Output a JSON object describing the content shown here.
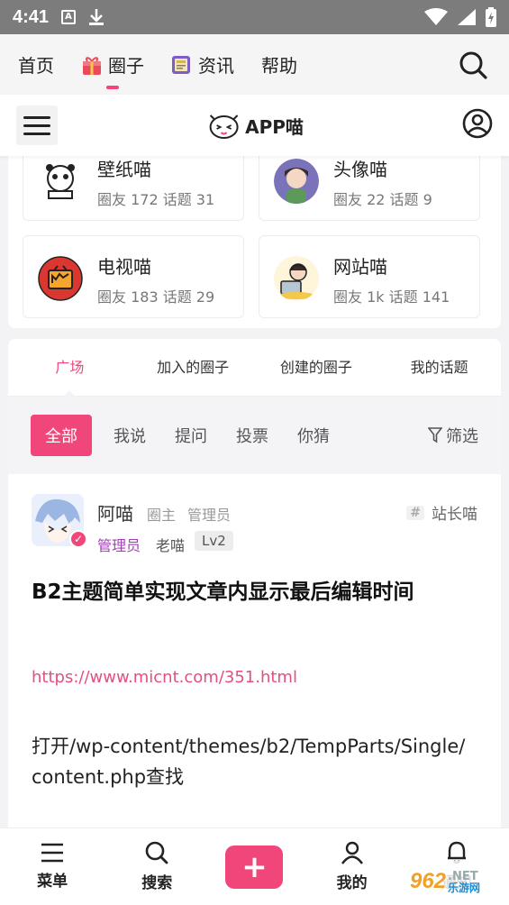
{
  "status_bar": {
    "time": "4:41"
  },
  "top_nav": {
    "items": [
      {
        "label": "首页",
        "icon": ""
      },
      {
        "label": "圈子",
        "icon": "gift-icon"
      },
      {
        "label": "资讯",
        "icon": "newspaper-icon"
      },
      {
        "label": "帮助",
        "icon": ""
      }
    ],
    "active_index": 1
  },
  "header": {
    "logo_text": "APP喵"
  },
  "circles": [
    {
      "name": "壁纸喵",
      "stats": "圈友 172 话题 31",
      "color": "#e5e5e5"
    },
    {
      "name": "头像喵",
      "stats": "圈友 22 话题 9",
      "color": "#7a73b9"
    },
    {
      "name": "电视喵",
      "stats": "圈友 183 话题 29",
      "color": "#d9372f"
    },
    {
      "name": "网站喵",
      "stats": "圈友 1k 话题 141",
      "color": "#f4c84a"
    }
  ],
  "tabs": [
    "广场",
    "加入的圈子",
    "创建的圈子",
    "我的话题"
  ],
  "filters": {
    "items": [
      "全部",
      "我说",
      "提问",
      "投票",
      "你猜"
    ],
    "filter_label": "筛选"
  },
  "post": {
    "author": "阿喵",
    "role_owner": "圈主",
    "role_admin": "管理员",
    "badge_admin": "管理员",
    "badge_title": "老喵",
    "level": "Lv2",
    "topic": "站长喵",
    "title": "B2主题简单实现文章内显示最后编辑时间",
    "link": "https://www.micnt.com/351.html",
    "body": "打开/wp-content/themes/b2/TempParts/Single/content.php查找"
  },
  "bottom_bar": {
    "menu": "菜单",
    "search": "搜索",
    "add": "+",
    "mine": "我的",
    "notify": "通知"
  },
  "watermark": {
    "logo": "962",
    "net": ".NET",
    "site": "乐游网"
  },
  "colors": {
    "accent": "#f0467a",
    "admin": "#a23fb8"
  }
}
